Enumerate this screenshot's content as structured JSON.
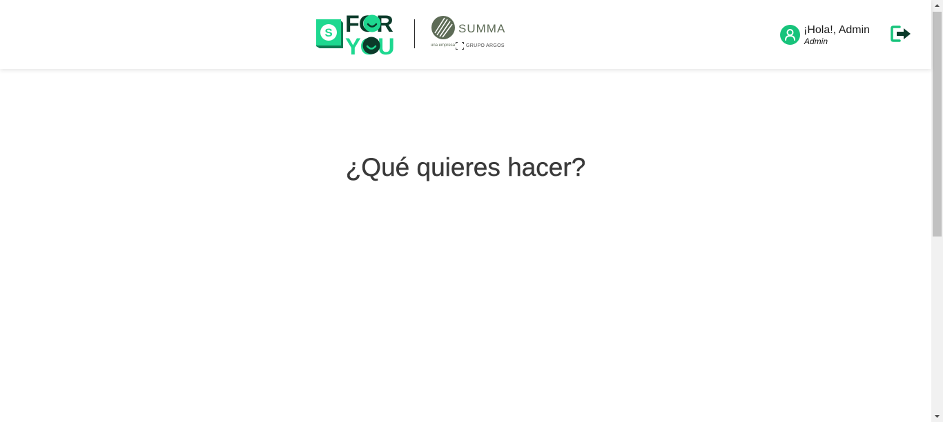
{
  "header": {
    "logo_primary": {
      "letter": "S",
      "line1": "FOR",
      "line2": "YOU"
    },
    "logo_secondary": {
      "name": "SUMMA",
      "subtext": "una empresa",
      "group": "GRUPO ARGOS"
    },
    "user": {
      "greeting": "¡Hola!, Admin",
      "role": "Admin"
    },
    "icons": {
      "avatar": "user-icon",
      "logout": "logout-icon"
    }
  },
  "main": {
    "title": "¿Qué quieres hacer?"
  },
  "colors": {
    "accent_green": "#17c37b",
    "dark_green": "#0b3b2a",
    "summa_olive": "#5d6b56",
    "title_text": "#3a3a3a"
  }
}
